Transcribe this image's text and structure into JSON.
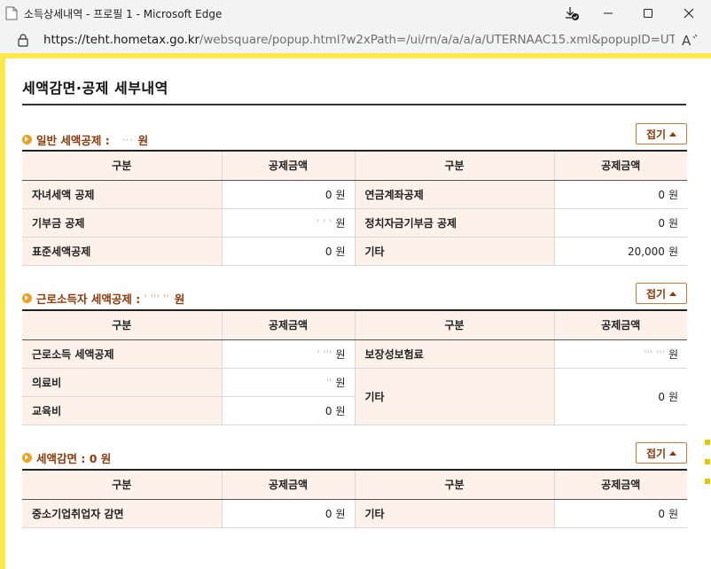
{
  "window": {
    "title": "소득상세내역 - 프로필 1 - Microsoft Edge",
    "url_host": "https://teht.hometax.go.kr",
    "url_rest": "/websquare/popup.html?w2xPath=/ui/rn/a/a/a/a/UTERNAAC15.xml&popupID=UTERN..."
  },
  "icons": {
    "app": "edge-page-icon",
    "download": "download-icon",
    "minimize": "minimize-icon",
    "maximize": "maximize-icon",
    "close": "close-icon",
    "lock": "lock-icon",
    "read_aloud": "read-aloud-icon",
    "bullet": "circle-arrow-bullet-icon",
    "fold": "triangle-up-icon"
  },
  "colors": {
    "frame": "#ffe84a",
    "section_title": "#8a3a0c",
    "header_bg": "#fdf1ea",
    "fold_border": "#c97a3a",
    "bullet": "#f0a020"
  },
  "page": {
    "title": "세액감면·공제 세부내역",
    "fold_label": "접기",
    "unit": "원"
  },
  "sections": [
    {
      "label": "일반 세액공제 :",
      "amount": "···",
      "unit": "원",
      "headers": [
        "구분",
        "공제금액",
        "구분",
        "공제금액"
      ],
      "rows": [
        {
          "l_label": "자녀세액 공제",
          "l_value": "0",
          "r_label": "연금계좌공제",
          "r_value": "0"
        },
        {
          "l_label": "기부금 공제",
          "l_value": "' ' '",
          "r_label": "정치자금기부금 공제",
          "r_value": "0"
        },
        {
          "l_label": "표준세액공제",
          "l_value": "0",
          "r_label": "기타",
          "r_value": "20,000"
        }
      ]
    },
    {
      "label": "근로소득자 세액공제 :",
      "amount": "' ''' ''",
      "unit": "원",
      "headers": [
        "구분",
        "공제금액",
        "구분",
        "공제금액"
      ],
      "rows": [
        {
          "l_label": "근로소득 세액공제",
          "l_value": "' '''",
          "r_label": "보장성보험료",
          "r_value": "''' '''"
        },
        {
          "l_label": "의료비",
          "l_value": "'' ",
          "r_label": "기타",
          "r_value": "0"
        },
        {
          "l_label": "교육비",
          "l_value": "0"
        }
      ]
    },
    {
      "label": "세액감면 : 0 원",
      "headers": [
        "구분",
        "공제금액",
        "구분",
        "공제금액"
      ],
      "rows": [
        {
          "l_label": "중소기업취업자 감면",
          "l_value": "0",
          "r_label": "기타",
          "r_value": "0"
        }
      ]
    }
  ]
}
